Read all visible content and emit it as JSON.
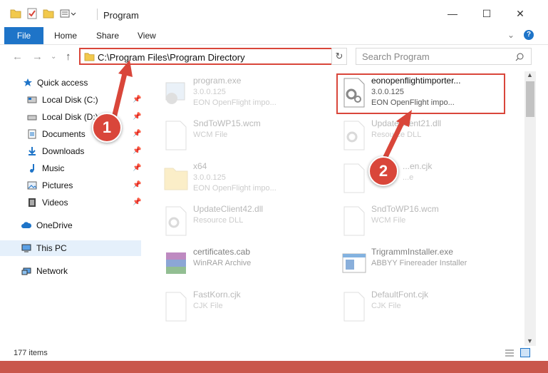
{
  "window": {
    "title": "Program"
  },
  "ribbon": {
    "tabs": [
      "File",
      "Home",
      "Share",
      "View"
    ]
  },
  "address": {
    "path": "C:\\Program Files\\Program Directory"
  },
  "search": {
    "placeholder": "Search Program"
  },
  "sidebar": {
    "items": [
      {
        "label": "Quick access"
      },
      {
        "label": "Local Disk (C:)"
      },
      {
        "label": "Local Disk (D:)"
      },
      {
        "label": "Documents"
      },
      {
        "label": "Downloads"
      },
      {
        "label": "Music"
      },
      {
        "label": "Pictures"
      },
      {
        "label": "Videos"
      },
      {
        "label": "OneDrive"
      },
      {
        "label": "This PC"
      },
      {
        "label": "Network"
      }
    ]
  },
  "files": [
    {
      "name": "program.exe",
      "line2": "3.0.0.125",
      "line3": "EON OpenFlight impo..."
    },
    {
      "name": "eonopenflightimporter...",
      "line2": "3.0.0.125",
      "line3": "EON OpenFlight impo..."
    },
    {
      "name": "SndToWP15.wcm",
      "line2": "WCM File",
      "line3": ""
    },
    {
      "name": "UpdateClient21.dll",
      "line2": "Resource DLL",
      "line3": ""
    },
    {
      "name": "x64",
      "line2": "3.0.0.125",
      "line3": "EON OpenFlight impo..."
    },
    {
      "name": "...en.cjk",
      "line2": "...e",
      "line3": ""
    },
    {
      "name": "UpdateClient42.dll",
      "line2": "Resource DLL",
      "line3": ""
    },
    {
      "name": "SndToWP16.wcm",
      "line2": "WCM File",
      "line3": ""
    },
    {
      "name": "certificates.cab",
      "line2": "WinRAR Archive",
      "line3": ""
    },
    {
      "name": "TrigrammInstaller.exe",
      "line2": "ABBYY Finereader Installer",
      "line3": ""
    },
    {
      "name": "FastKorn.cjk",
      "line2": "CJK File",
      "line3": ""
    },
    {
      "name": "DefaultFont.cjk",
      "line2": "CJK File",
      "line3": ""
    }
  ],
  "status": {
    "count": "177 items"
  },
  "callouts": [
    "1",
    "2"
  ]
}
